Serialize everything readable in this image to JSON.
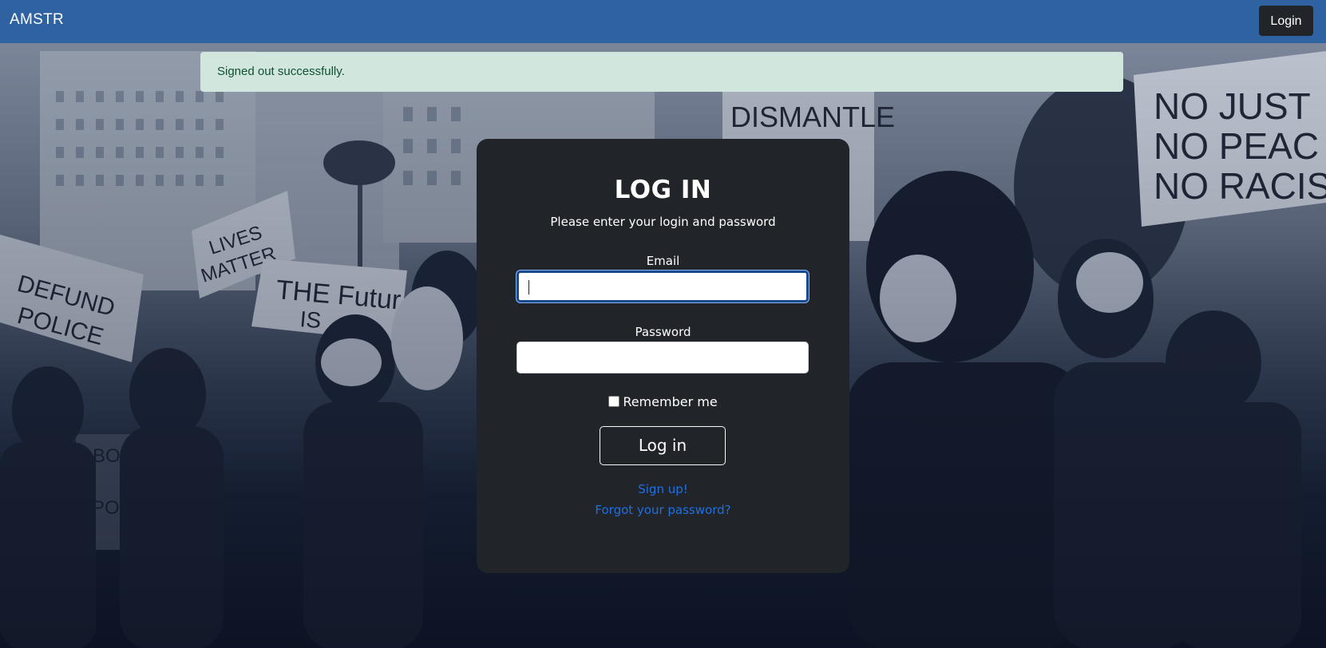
{
  "navbar": {
    "brand": "AMSTR",
    "login_button": "Login",
    "background_color": "#2f62a1"
  },
  "alert": {
    "message": "Signed out successfully.",
    "background_color": "#d1e7dd"
  },
  "login_card": {
    "title": "LOG IN",
    "subtitle": "Please enter your login and password",
    "email_label": "Email",
    "email_value": "",
    "password_label": "Password",
    "password_value": "",
    "remember_label": "Remember me",
    "remember_checked": false,
    "submit_label": "Log in",
    "signup_link": "Sign up!",
    "forgot_link": "Forgot your password?",
    "link_color": "#1f6fe0"
  },
  "background": {
    "signs": [
      "DEFUND POLICE",
      "LIVES MATTER",
      "THE FUTURE IS NOW",
      "DISMANTLE",
      "NO JUSTICE NO PEACE NO RACIST POLICE",
      "ABOLISH POLICE"
    ]
  }
}
